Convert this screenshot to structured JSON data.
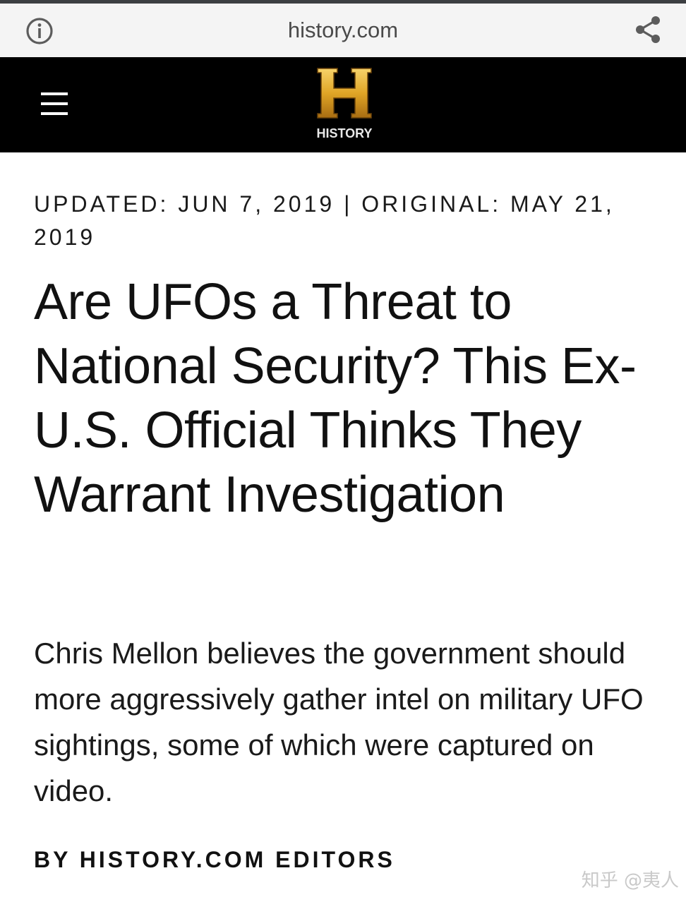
{
  "browser": {
    "url": "history.com",
    "info_icon": "info-circle-icon",
    "share_icon": "share-icon"
  },
  "site_header": {
    "menu_icon": "hamburger-menu-icon",
    "logo_letter": "H",
    "logo_wordmark": "HISTORY",
    "background_color": "#000000",
    "logo_color": "#e0a526"
  },
  "article": {
    "dateline": "UPDATED: JUN 7, 2019 | ORIGINAL: MAY 21, 2019",
    "headline": "Are UFOs a Threat to National Security? This Ex-U.S. Official Thinks They Warrant Investigation",
    "summary": "Chris Mellon believes the government should more aggressively gather intel on military UFO sightings, some of which were captured on video.",
    "byline": "BY HISTORY.COM EDITORS"
  },
  "watermark": {
    "text": "知乎 @夷人"
  }
}
